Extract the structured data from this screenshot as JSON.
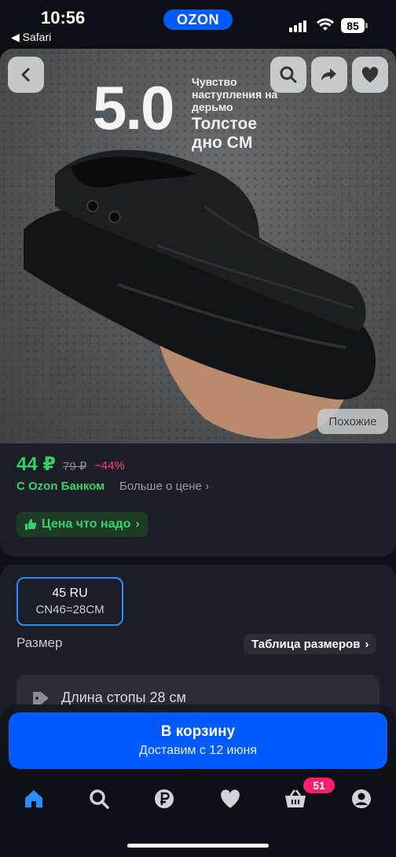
{
  "status_bar": {
    "time": "10:56",
    "back_app": "◀ Safari",
    "battery": "85",
    "brand": "OZON"
  },
  "product_image": {
    "rating": "5.0",
    "promo_small": "Чувство наступления на дерьмо",
    "promo_big": "Толстое дно CM",
    "similar_label": "Похожие"
  },
  "price": {
    "current": "44 ₽",
    "old": "79 ₽",
    "discount": "−44%",
    "bank": "С Ozon Банком",
    "more": "Больше о цене",
    "good_price_label": "Цена что надо"
  },
  "size": {
    "selected_ru": "45 RU",
    "selected_cn": "CN46=28CM",
    "label": "Размер",
    "table_button": "Таблица размеров",
    "foot_length": "Длина стопы 28 см"
  },
  "cart": {
    "button_label": "В корзину",
    "delivery": "Доставим с 12 июня"
  },
  "nav": {
    "cart_badge": "51"
  },
  "colors": {
    "accent": "#005bff",
    "green": "#34d16b",
    "pink": "#ff3d7a",
    "badge": "#ff1f6b",
    "chip_border": "#2a8dff"
  }
}
